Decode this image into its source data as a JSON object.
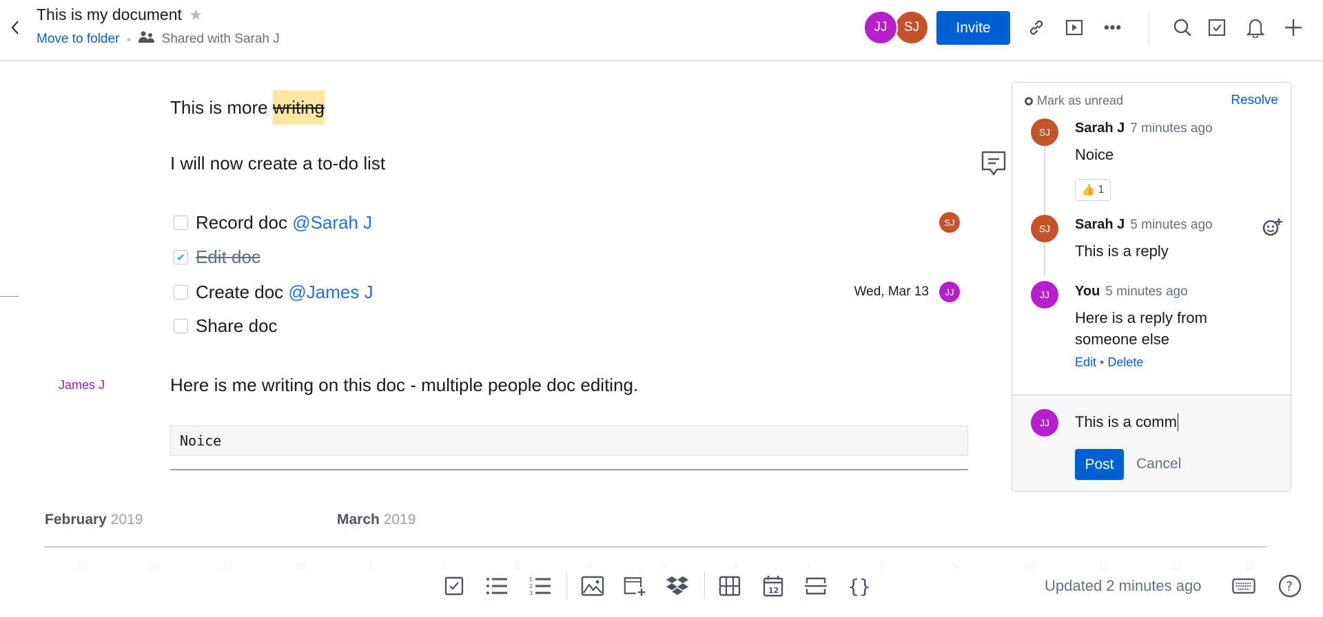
{
  "header": {
    "title": "This is my document",
    "move_to_folder": "Move to folder",
    "shared_with": "Shared with Sarah J",
    "avatars": [
      {
        "initials": "JJ",
        "color": "#b61fcc"
      },
      {
        "initials": "SJ",
        "color": "#c4532b"
      }
    ],
    "invite_label": "Invite",
    "accent": "#0061d5"
  },
  "doc": {
    "line1_prefix": "This is more ",
    "line1_strike": "writing",
    "line2": "I will now create a to-do list",
    "todos": [
      {
        "text": "Record doc ",
        "mention": "@Sarah J",
        "checked": false,
        "assignee": "SJ"
      },
      {
        "text": "Edit doc",
        "mention": "",
        "checked": true
      },
      {
        "text": "Create doc ",
        "mention": "@James J",
        "checked": false,
        "due": "Wed, Mar 13",
        "assignee": "JJ"
      },
      {
        "text": "Share doc",
        "mention": "",
        "checked": false
      }
    ],
    "cursor_label": "James J",
    "line3": "Here is me writing on this doc - multiple people doc editing.",
    "code": "Noice"
  },
  "calendar": {
    "month1": "February",
    "year1": "2019",
    "month2": "March",
    "year2": "2019",
    "dates": [
      "25",
      "26",
      "27",
      "28",
      "1",
      "2",
      "3",
      "4",
      "5",
      "6",
      "7",
      "8",
      "9",
      "10",
      "11",
      "12",
      "13"
    ]
  },
  "comments": {
    "mark_unread": "Mark as unread",
    "resolve": "Resolve",
    "items": [
      {
        "initials": "SJ",
        "name": "Sarah J",
        "time": "7 minutes ago",
        "text": "Noice",
        "reaction": "👍",
        "reaction_count": "1"
      },
      {
        "initials": "SJ",
        "name": "Sarah J",
        "time": "5 minutes ago",
        "text": "This is a reply"
      },
      {
        "initials": "JJ",
        "name": "You",
        "time": "5 minutes ago",
        "text": "Here is a reply from someone else",
        "edit": "Edit",
        "sep": "•",
        "delete": "Delete"
      }
    ],
    "composer": {
      "initials": "JJ",
      "value": "This is a comm",
      "post": "Post",
      "cancel": "Cancel"
    }
  },
  "footer": {
    "updated": "Updated 2 minutes ago"
  }
}
